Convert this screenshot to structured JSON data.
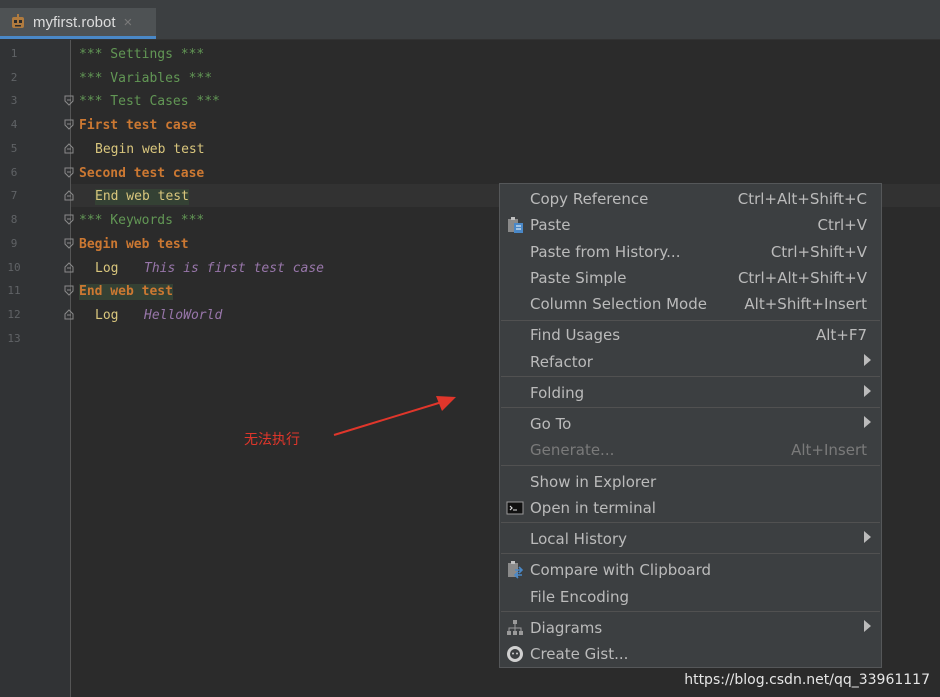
{
  "tab": {
    "title": "myfirst.robot",
    "close": "×"
  },
  "gutter": {
    "line_numbers": [
      "1",
      "2",
      "3",
      "4",
      "5",
      "6",
      "7",
      "8",
      "9",
      "10",
      "11",
      "12",
      "13"
    ]
  },
  "code": {
    "l1": "*** Settings ***",
    "l2": "*** Variables ***",
    "l3": "*** Test Cases ***",
    "l4": "First test case",
    "l5": "Begin web test",
    "l6": "Second test case",
    "l7": "End web test",
    "l8": "*** Keywords ***",
    "l9": "Begin web test",
    "l10_kw": "Log",
    "l10_arg": "This is first test case",
    "l11": "End web test",
    "l12_kw": "Log",
    "l12_arg": "HelloWorld"
  },
  "annotation": {
    "text": "无法执行",
    "color": "#e0362b"
  },
  "context_menu": {
    "items": [
      {
        "label": "Copy Reference",
        "shortcut": "Ctrl+Alt+Shift+C"
      },
      {
        "label": "Paste",
        "shortcut": "Ctrl+V",
        "icon": "clipboard-paste-icon"
      },
      {
        "label": "Paste from History...",
        "shortcut": "Ctrl+Shift+V"
      },
      {
        "label": "Paste Simple",
        "shortcut": "Ctrl+Alt+Shift+V"
      },
      {
        "label": "Column Selection Mode",
        "shortcut": "Alt+Shift+Insert"
      },
      {
        "label": "Find Usages",
        "shortcut": "Alt+F7"
      },
      {
        "label": "Refactor",
        "submenu": true
      },
      {
        "label": "Folding",
        "submenu": true
      },
      {
        "label": "Go To",
        "submenu": true
      },
      {
        "label": "Generate...",
        "shortcut": "Alt+Insert",
        "disabled": true
      },
      {
        "label": "Show in Explorer"
      },
      {
        "label": "Open in terminal",
        "icon": "terminal-icon"
      },
      {
        "label": "Local History",
        "submenu": true
      },
      {
        "label": "Compare with Clipboard",
        "icon": "compare-clipboard-icon"
      },
      {
        "label": "File Encoding"
      },
      {
        "label": "Diagrams",
        "submenu": true,
        "icon": "diagram-icon"
      },
      {
        "label": "Create Gist...",
        "icon": "github-icon"
      }
    ]
  },
  "watermark": "https://blog.csdn.net/qq_33961117",
  "colors": {
    "editor_bg": "#2b2b2b",
    "menu_bg": "#3c3f41",
    "comment": "#629755",
    "section_header": "#cc7832",
    "keyword": "#d9c67d",
    "argument": "#9876aa"
  }
}
